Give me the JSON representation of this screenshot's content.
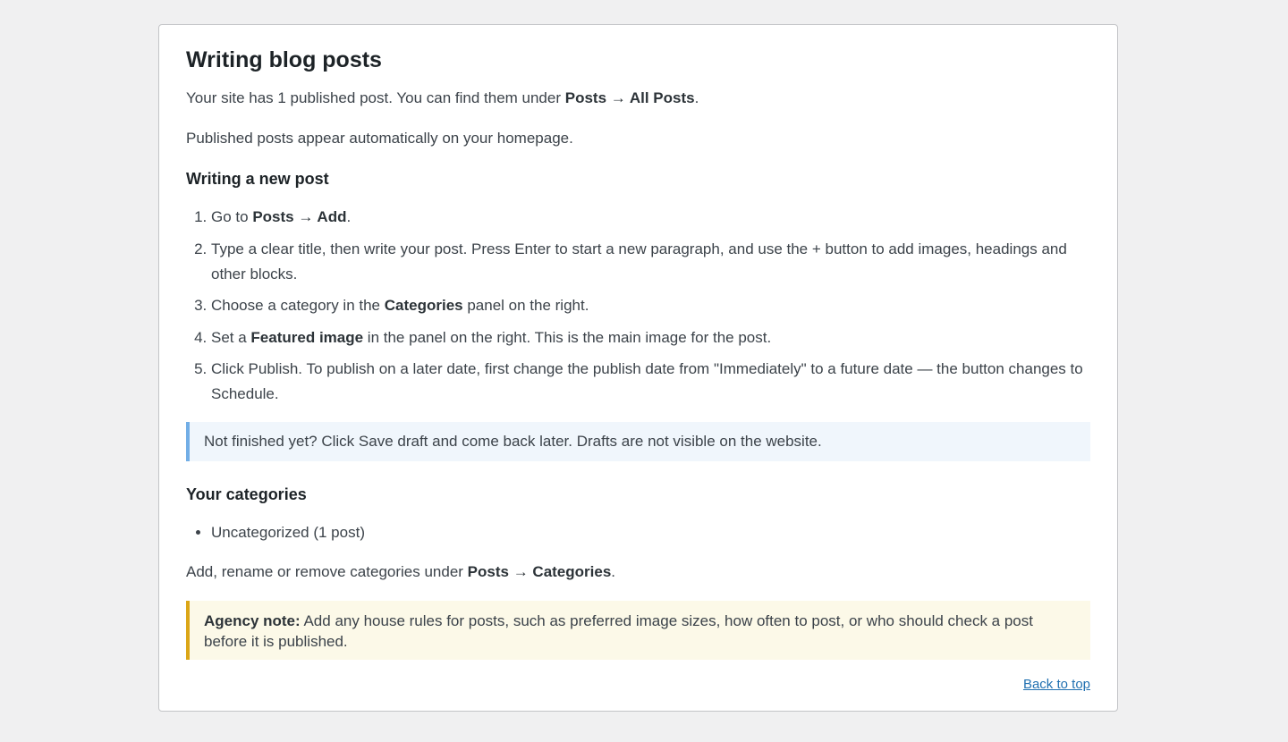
{
  "title": "Writing blog posts",
  "intro": {
    "p1_prefix": "Your site has 1 published post. You can find them under ",
    "p1_path": "Posts → All Posts",
    "p1_suffix": ".",
    "p2": "Published posts appear automatically on your homepage."
  },
  "new_post": {
    "heading": "Writing a new post",
    "steps": [
      {
        "prefix": "Go to ",
        "bold": "Posts → Add",
        "suffix": "."
      },
      {
        "text": "Type a clear title, then write your post. Press Enter to start a new paragraph, and use the + button to add images, headings and other blocks."
      },
      {
        "prefix": "Choose a category in the ",
        "bold": "Categories",
        "suffix": " panel on the right."
      },
      {
        "prefix": "Set a ",
        "bold": "Featured image",
        "suffix": " in the panel on the right. This is the main image for the post."
      },
      {
        "text": "Click Publish. To publish on a later date, first change the publish date from \"Immediately\" to a future date — the button changes to Schedule."
      }
    ]
  },
  "info_notice": "Not finished yet? Click Save draft and come back later. Drafts are not visible on the website.",
  "categories": {
    "heading": "Your categories",
    "items": [
      "Uncategorized (1 post)"
    ],
    "manage_prefix": "Add, rename or remove categories under ",
    "manage_path": "Posts → Categories",
    "manage_suffix": "."
  },
  "agency_note": {
    "label": "Agency note:",
    "text": " Add any house rules for posts, such as preferred image sizes, how often to post, or who should check a post before it is published."
  },
  "back_to_top": "Back to top",
  "colors": {
    "info_border": "#72aee6",
    "info_bg": "#f0f6fc",
    "warn_border": "#dba617",
    "warn_bg": "#fcf9e8",
    "link": "#2271b1"
  }
}
